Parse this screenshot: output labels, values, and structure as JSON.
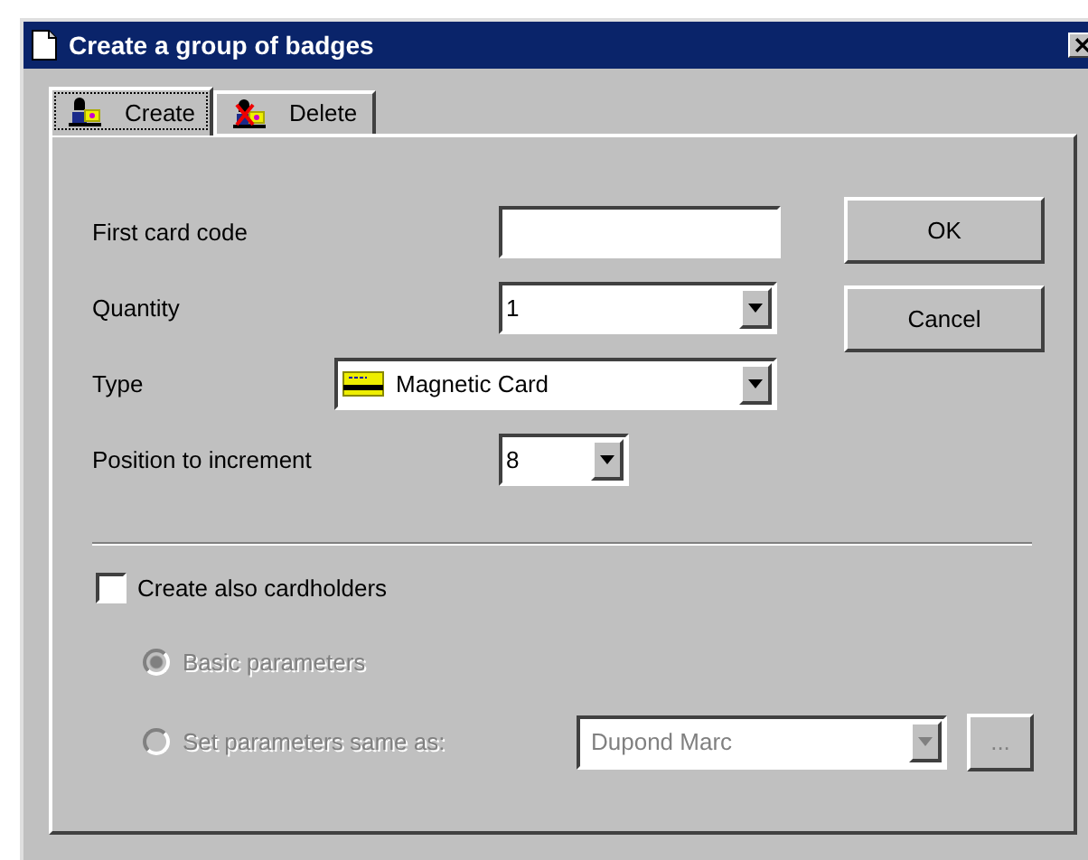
{
  "window": {
    "title": "Create a group of badges"
  },
  "tabs": [
    {
      "label": "Create",
      "selected": true,
      "kind": "create"
    },
    {
      "label": "Delete",
      "selected": false,
      "kind": "delete"
    }
  ],
  "fields": [
    {
      "label": "First card code",
      "kind": "text"
    },
    {
      "label": "Quantity",
      "kind": "combo",
      "value": "1"
    },
    {
      "label": "Type",
      "kind": "iconcombo",
      "value": "Magnetic Card"
    },
    {
      "label": "Position to increment",
      "kind": "small",
      "value": "8"
    }
  ],
  "buttons": [
    "OK",
    "Cancel"
  ],
  "cardholders": {
    "label": "Create also cardholders",
    "checked": false,
    "options": [
      {
        "label": "Basic parameters",
        "selected": true,
        "disabled": true
      },
      {
        "label": "Set parameters same as:",
        "selected": false,
        "disabled": true
      }
    ],
    "same_as": {
      "value": "Dupond Marc",
      "disabled": true
    },
    "browse_button": "..."
  }
}
